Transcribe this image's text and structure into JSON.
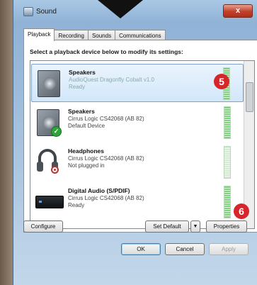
{
  "window": {
    "title": "Sound",
    "close_symbol": "x"
  },
  "tabs": [
    {
      "label": "Playback",
      "active": true
    },
    {
      "label": "Recording",
      "active": false
    },
    {
      "label": "Sounds",
      "active": false
    },
    {
      "label": "Communications",
      "active": false
    }
  ],
  "panel": {
    "instruction": "Select a playback device below to modify its settings:"
  },
  "devices": [
    {
      "name": "Speakers",
      "line2": "AudioQuest Dragonfly Cobalt v1.0",
      "line3": "Ready",
      "icon": "speaker-icon",
      "selected": true
    },
    {
      "name": "Speakers",
      "line2": "Cirrus Logic CS42068 (AB 82)",
      "line3": "Default Device",
      "icon": "speaker-icon",
      "status_icon": "checkmark-icon"
    },
    {
      "name": "Headphones",
      "line2": "Cirrus Logic CS42068 (AB 82)",
      "line3": "Not plugged in",
      "icon": "headphones-icon",
      "status_icon": "unplugged-icon"
    },
    {
      "name": "Digital Audio (S/PDIF)",
      "line2": "Cirrus Logic CS42068 (AB 82)",
      "line3": "Ready",
      "icon": "spdif-icon"
    }
  ],
  "callouts": {
    "step5": "5",
    "step6": "6"
  },
  "buttons": {
    "configure": "Configure",
    "set_default": "Set Default",
    "set_default_arrow": "▼",
    "properties": "Properties",
    "ok": "OK",
    "cancel": "Cancel",
    "apply": "Apply"
  },
  "colors": {
    "callout": "#d7262b",
    "selection": "#d2e7fa",
    "check": "#31a33b"
  }
}
